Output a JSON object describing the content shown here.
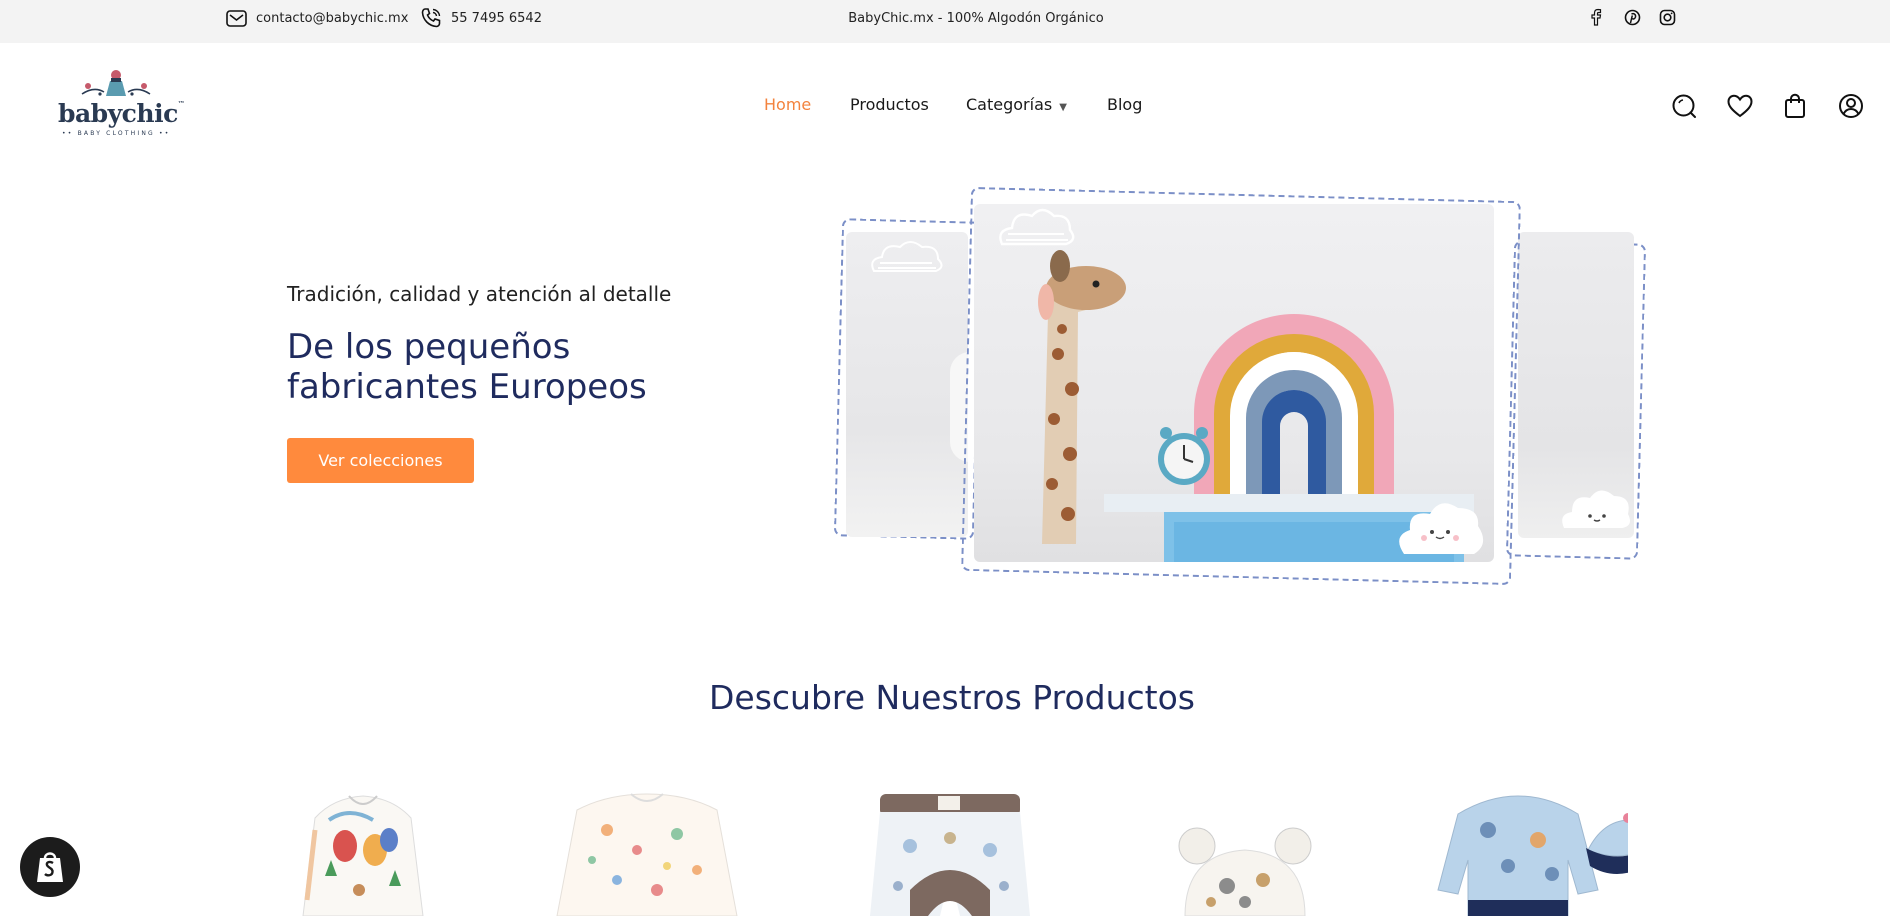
{
  "topbar": {
    "email": "contacto@babychic.mx",
    "phone": "55 7495 6542",
    "tagline": "BabyChic.mx - 100% Algodón Orgánico",
    "social_icons": [
      "facebook-icon",
      "pinterest-icon",
      "instagram-icon"
    ]
  },
  "logo": {
    "word": "babychic",
    "sub": "BABY CLOTHING"
  },
  "nav": {
    "items": [
      {
        "label": "Home"
      },
      {
        "label": "Productos"
      },
      {
        "label": "Categorías"
      },
      {
        "label": "Blog"
      }
    ]
  },
  "header_icons": [
    "search-icon",
    "heart-icon",
    "bag-icon",
    "user-icon"
  ],
  "hero": {
    "eyebrow": "Tradición, calidad y atención al detalle",
    "title": "De los pequeños fabricantes Europeos",
    "button": "Ver colecciones"
  },
  "products_section": {
    "title": "Descubre Nuestros Productos"
  },
  "colors": {
    "accent": "#ff8a3d",
    "heading": "#1f2b5e",
    "topbar_bg": "#f3f3f3"
  }
}
